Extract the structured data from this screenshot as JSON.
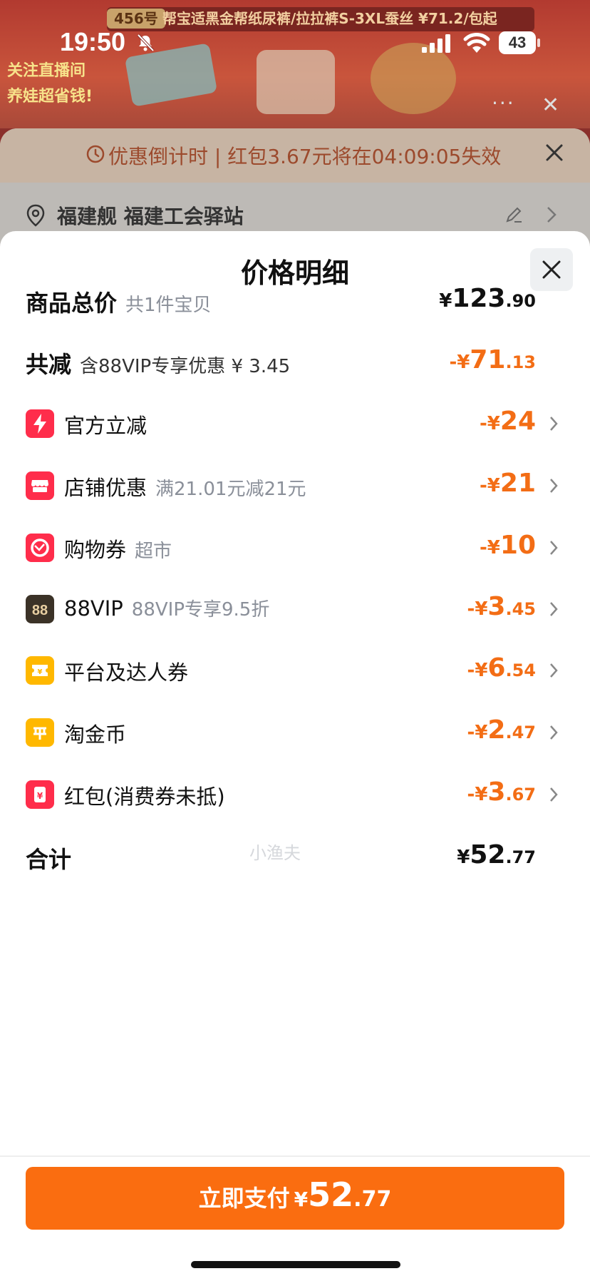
{
  "status_bar": {
    "time": "19:50",
    "battery": "43"
  },
  "background": {
    "strip_tag": "456号",
    "strip_text": "帮宝适黑金帮纸尿裤/拉拉裤S-3XL蚕丝 ¥71.2/包起",
    "promo_line1": "关注直播间",
    "promo_line2": "养娃超省钱!",
    "more": "···",
    "close": "✕",
    "countdown": "优惠倒计时 | 红包3.67元将在04:09:05失效",
    "address": "福建舰 福建工会驿站"
  },
  "sheet": {
    "title": "价格明细",
    "total": {
      "label": "商品总价",
      "sub": "共1件宝贝",
      "sym": "¥",
      "int": "123",
      "dec": ".90"
    },
    "reduction": {
      "label": "共减",
      "sub": "含88VIP专享优惠 ¥ 3.45",
      "sym": "-¥",
      "int": "71",
      "dec": ".13"
    },
    "items": [
      {
        "label": "官方立减",
        "sub": "",
        "sym": "-¥",
        "int": "24",
        "dec": "",
        "icon": "lightning-icon",
        "color": "#ff2d4b"
      },
      {
        "label": "店铺优惠",
        "sub": "满21.01元减21元",
        "sym": "-¥",
        "int": "21",
        "dec": "",
        "icon": "shop-icon",
        "color": "#ff2d4b"
      },
      {
        "label": "购物券",
        "sub": "超市",
        "sym": "-¥",
        "int": "10",
        "dec": "",
        "icon": "coupon-icon",
        "color": "#ff2d4b"
      },
      {
        "label": "88VIP",
        "sub": "88VIP专享9.5折",
        "sym": "-¥",
        "int": "3",
        "dec": ".45",
        "icon": "vip88-icon",
        "color": "#3b3227"
      },
      {
        "label": "平台及达人券",
        "sub": "",
        "sym": "-¥",
        "int": "6",
        "dec": ".54",
        "icon": "ticket-icon",
        "color": "#ffb800"
      },
      {
        "label": "淘金币",
        "sub": "",
        "sym": "-¥",
        "int": "2",
        "dec": ".47",
        "icon": "coin-icon",
        "color": "#ffb800"
      },
      {
        "label": "红包(消费券未抵)",
        "sub": "",
        "sym": "-¥",
        "int": "3",
        "dec": ".67",
        "icon": "red-packet-icon",
        "color": "#ff2d4b"
      }
    ],
    "sum": {
      "label": "合计",
      "sym": "¥",
      "int": "52",
      "dec": ".77"
    },
    "watermark": "小渔夫"
  },
  "pay": {
    "label": "立即支付",
    "sym": "¥",
    "int": "52",
    "dec": ".77"
  }
}
